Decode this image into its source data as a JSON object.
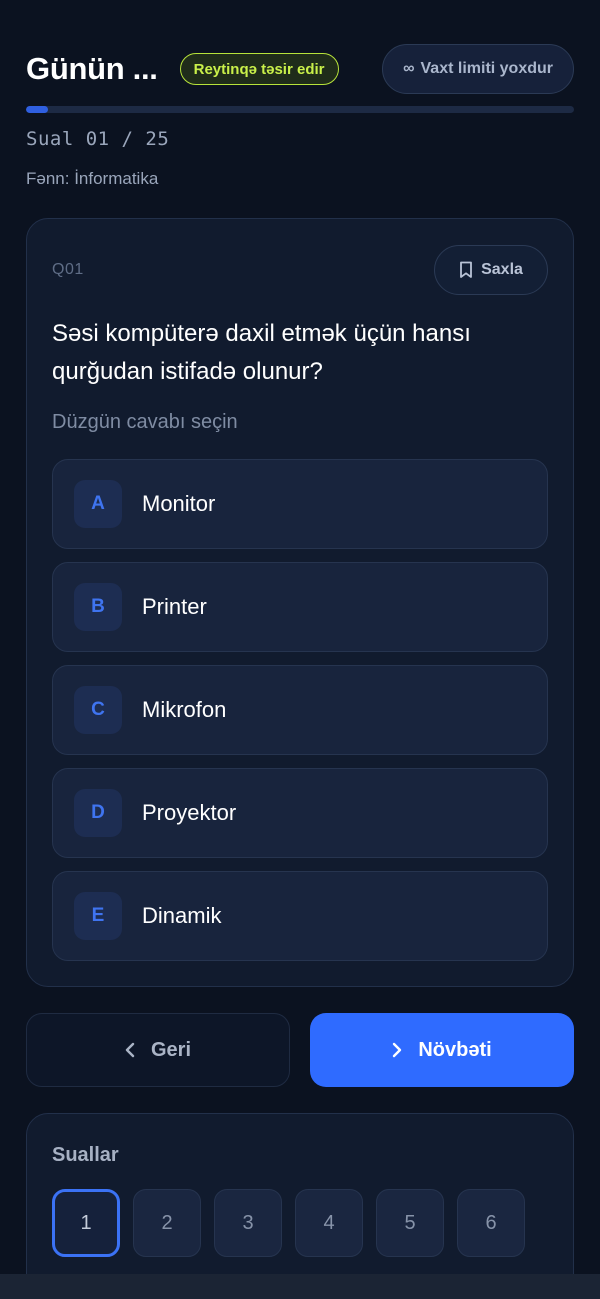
{
  "header": {
    "title": "Günün ...",
    "badge": "Reytinqə təsir edir",
    "time_limit": "Vaxt limiti yoxdur",
    "time_icon": "infinity-icon"
  },
  "progress": {
    "current": 1,
    "total": 25,
    "fraction": 0.04
  },
  "counter": "Sual 01 / 25",
  "subject": "Fənn: İnformatika",
  "question": {
    "id": "Q01",
    "save_label": "Saxla",
    "text": "Səsi kompüterə daxil etmək üçün hansı qurğudan istifadə olunur?",
    "hint": "Düzgün cavabı seçin",
    "options": [
      {
        "letter": "A",
        "text": "Monitor"
      },
      {
        "letter": "B",
        "text": "Printer"
      },
      {
        "letter": "C",
        "text": "Mikrofon"
      },
      {
        "letter": "D",
        "text": "Proyektor"
      },
      {
        "letter": "E",
        "text": "Dinamik"
      }
    ]
  },
  "nav": {
    "back_label": "Geri",
    "next_label": "Növbəti"
  },
  "questions_panel": {
    "title": "Suallar",
    "items": [
      "1",
      "2",
      "3",
      "4",
      "5",
      "6"
    ],
    "active_index": 0
  },
  "colors": {
    "background": "#0b1220",
    "accent": "#2f6bff",
    "badge": "#c9f04a"
  }
}
